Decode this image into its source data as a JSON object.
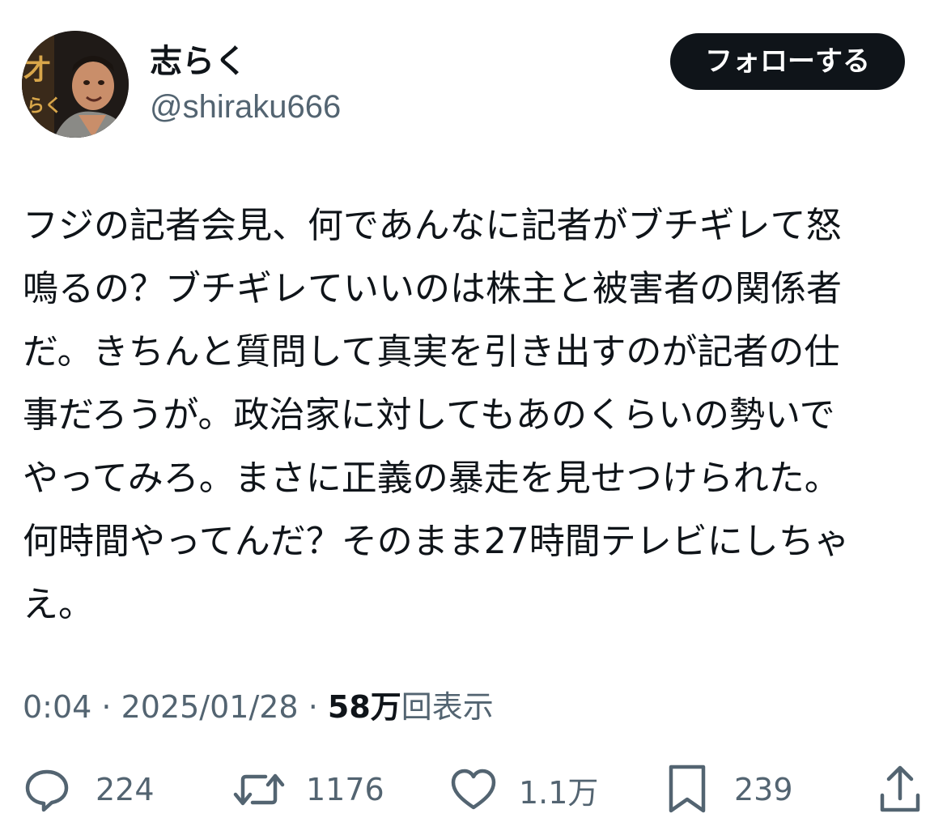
{
  "user": {
    "display_name": "志らく",
    "handle": "@shiraku666",
    "avatar_banner_text": "才 らく"
  },
  "follow_button": {
    "label": "フォローする"
  },
  "tweet": {
    "lines": [
      "フジの記者会見、何であんなに記者がブチギレて怒",
      "鳴るの？ブチギレていいのは株主と被害者の関係者",
      "だ。きちんと質問して真実を引き出すのが記者の仕",
      "事だろうが。政治家に対してもあのくらいの勢いで",
      "やってみろ。まさに正義の暴走を見せつけられた。",
      "何時間やってんだ？そのまま27時間テレビにしちゃ",
      "え。"
    ]
  },
  "meta": {
    "time": "0:04",
    "separator": " · ",
    "date": "2025/01/28",
    "views_count": "58万",
    "views_label": "回表示"
  },
  "actions": {
    "replies": {
      "count": "224",
      "icon": "reply-icon"
    },
    "reposts": {
      "count": "1176",
      "icon": "repost-icon"
    },
    "likes": {
      "count": "1.1万",
      "icon": "like-icon"
    },
    "bookmarks": {
      "count": "239",
      "icon": "bookmark-icon"
    },
    "share": {
      "icon": "share-icon"
    }
  },
  "colors": {
    "text": "#0f1419",
    "secondary": "#536471",
    "button_bg": "#0f1419",
    "button_text": "#ffffff"
  }
}
